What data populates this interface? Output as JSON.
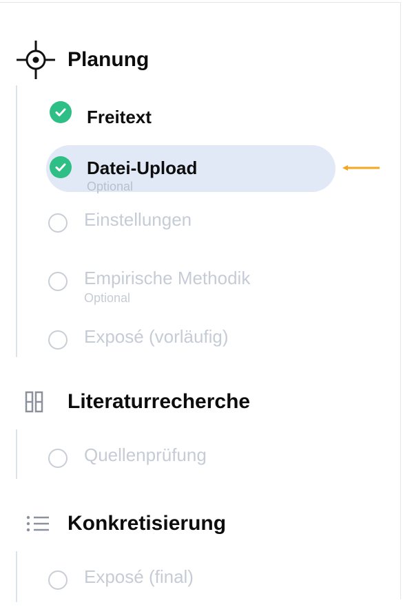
{
  "sections": [
    {
      "title": "Planung",
      "icon": "crosshair-icon",
      "steps": [
        {
          "label": "Freitext",
          "status": "done"
        },
        {
          "label": "Datei-Upload",
          "sub": "Optional",
          "status": "done",
          "active": true
        },
        {
          "label": "Einstellungen",
          "status": "todo"
        },
        {
          "label": "Empirische Methodik",
          "sub": "Optional",
          "status": "todo"
        },
        {
          "label": "Exposé (vorläufig)",
          "status": "todo"
        }
      ]
    },
    {
      "title": "Literaturrecherche",
      "icon": "columns-icon",
      "steps": [
        {
          "label": "Quellenprüfung",
          "status": "todo"
        }
      ]
    },
    {
      "title": "Konkretisierung",
      "icon": "list-icon",
      "steps": [
        {
          "label": "Exposé (final)",
          "status": "todo"
        }
      ]
    }
  ],
  "colors": {
    "done": "#2dbf85",
    "active_bg": "#e1e9f6",
    "arrow": "#f5a623",
    "todo_text": "#c5ccd6"
  }
}
